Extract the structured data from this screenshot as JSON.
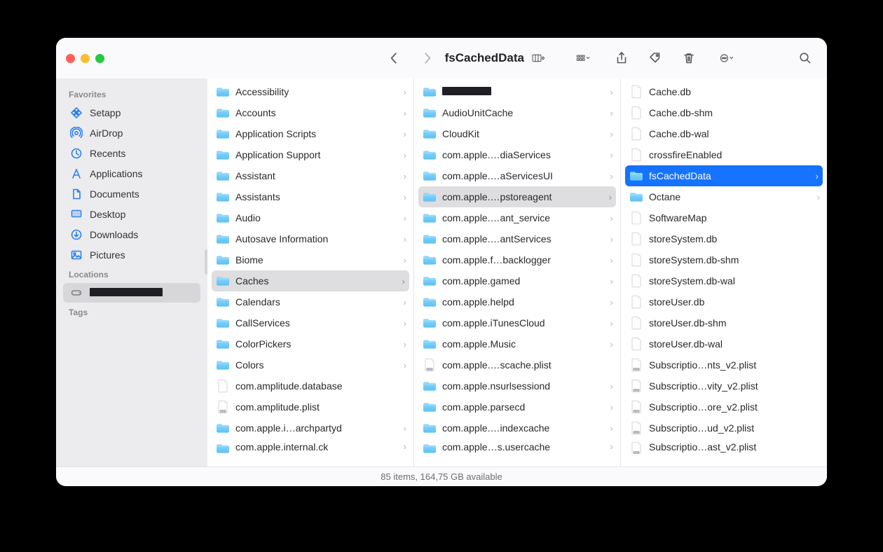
{
  "window": {
    "title": "fsCachedData"
  },
  "sidebar": {
    "sections": [
      {
        "heading": "Favorites",
        "items": [
          {
            "label": "Setapp",
            "icon": "grid-diamond"
          },
          {
            "label": "AirDrop",
            "icon": "airdrop"
          },
          {
            "label": "Recents",
            "icon": "clock"
          },
          {
            "label": "Applications",
            "icon": "app-a"
          },
          {
            "label": "Documents",
            "icon": "doc"
          },
          {
            "label": "Desktop",
            "icon": "desktop"
          },
          {
            "label": "Downloads",
            "icon": "download"
          },
          {
            "label": "Pictures",
            "icon": "pictures"
          }
        ]
      },
      {
        "heading": "Locations",
        "items": [
          {
            "label": "",
            "icon": "disk",
            "redacted": true,
            "selected": true
          }
        ]
      },
      {
        "heading": "Tags",
        "items": []
      }
    ]
  },
  "columns": [
    {
      "items": [
        {
          "name": "Accessibility",
          "type": "folder",
          "sub": true
        },
        {
          "name": "Accounts",
          "type": "folder",
          "sub": true
        },
        {
          "name": "Application Scripts",
          "type": "folder",
          "sub": true
        },
        {
          "name": "Application Support",
          "type": "folder",
          "sub": true
        },
        {
          "name": "Assistant",
          "type": "folder",
          "sub": true
        },
        {
          "name": "Assistants",
          "type": "folder",
          "sub": true
        },
        {
          "name": "Audio",
          "type": "folder",
          "sub": true
        },
        {
          "name": "Autosave Information",
          "type": "folder",
          "sub": true
        },
        {
          "name": "Biome",
          "type": "folder",
          "sub": true
        },
        {
          "name": "Caches",
          "type": "folder",
          "sub": true,
          "state": "path"
        },
        {
          "name": "Calendars",
          "type": "folder",
          "sub": true
        },
        {
          "name": "CallServices",
          "type": "folder",
          "sub": true
        },
        {
          "name": "ColorPickers",
          "type": "folder",
          "sub": true
        },
        {
          "name": "Colors",
          "type": "folder",
          "sub": true
        },
        {
          "name": "com.amplitude.database",
          "type": "file",
          "sub": false
        },
        {
          "name": "com.amplitude.plist",
          "type": "plist",
          "sub": false
        },
        {
          "name": "com.apple.i…archpartyd",
          "type": "folder",
          "sub": true
        },
        {
          "name": "com.apple.internal.ck",
          "type": "folder",
          "sub": true,
          "cut": true
        }
      ]
    },
    {
      "items": [
        {
          "name": "",
          "type": "folder",
          "sub": true,
          "redacted": true
        },
        {
          "name": "AudioUnitCache",
          "type": "folder",
          "sub": true
        },
        {
          "name": "CloudKit",
          "type": "folder",
          "sub": true
        },
        {
          "name": "com.apple.…diaServices",
          "type": "folder",
          "sub": true
        },
        {
          "name": "com.apple.…aServicesUI",
          "type": "folder",
          "sub": true
        },
        {
          "name": "com.apple.…pstoreagent",
          "type": "folder",
          "sub": true,
          "state": "path"
        },
        {
          "name": "com.apple.…ant_service",
          "type": "folder",
          "sub": true
        },
        {
          "name": "com.apple.…antServices",
          "type": "folder",
          "sub": true
        },
        {
          "name": "com.apple.f…backlogger",
          "type": "folder",
          "sub": true
        },
        {
          "name": "com.apple.gamed",
          "type": "folder",
          "sub": true
        },
        {
          "name": "com.apple.helpd",
          "type": "folder",
          "sub": true
        },
        {
          "name": "com.apple.iTunesCloud",
          "type": "folder",
          "sub": true
        },
        {
          "name": "com.apple.Music",
          "type": "folder",
          "sub": true
        },
        {
          "name": "com.apple.…scache.plist",
          "type": "plist",
          "sub": false
        },
        {
          "name": "com.apple.nsurlsessiond",
          "type": "folder",
          "sub": true
        },
        {
          "name": "com.apple.parsecd",
          "type": "folder",
          "sub": true
        },
        {
          "name": "com.apple.…indexcache",
          "type": "folder",
          "sub": true
        },
        {
          "name": "com.apple…s.usercache",
          "type": "folder",
          "sub": true,
          "cut": true
        }
      ]
    },
    {
      "items": [
        {
          "name": "Cache.db",
          "type": "file",
          "sub": false
        },
        {
          "name": "Cache.db-shm",
          "type": "file",
          "sub": false
        },
        {
          "name": "Cache.db-wal",
          "type": "file",
          "sub": false
        },
        {
          "name": "crossfireEnabled",
          "type": "file",
          "sub": false
        },
        {
          "name": "fsCachedData",
          "type": "folder",
          "sub": true,
          "state": "selected"
        },
        {
          "name": "Octane",
          "type": "folder",
          "sub": true
        },
        {
          "name": "SoftwareMap",
          "type": "file",
          "sub": false
        },
        {
          "name": "storeSystem.db",
          "type": "file",
          "sub": false
        },
        {
          "name": "storeSystem.db-shm",
          "type": "file",
          "sub": false
        },
        {
          "name": "storeSystem.db-wal",
          "type": "file",
          "sub": false
        },
        {
          "name": "storeUser.db",
          "type": "file",
          "sub": false
        },
        {
          "name": "storeUser.db-shm",
          "type": "file",
          "sub": false
        },
        {
          "name": "storeUser.db-wal",
          "type": "file",
          "sub": false
        },
        {
          "name": "Subscriptio…nts_v2.plist",
          "type": "plist",
          "sub": false
        },
        {
          "name": "Subscriptio…vity_v2.plist",
          "type": "plist",
          "sub": false
        },
        {
          "name": "Subscriptio…ore_v2.plist",
          "type": "plist",
          "sub": false
        },
        {
          "name": "Subscriptio…ud_v2.plist",
          "type": "plist",
          "sub": false
        },
        {
          "name": "Subscriptio…ast_v2.plist",
          "type": "plist",
          "sub": false,
          "cut": true
        }
      ]
    }
  ],
  "status": "85 items, 164,75 GB available"
}
